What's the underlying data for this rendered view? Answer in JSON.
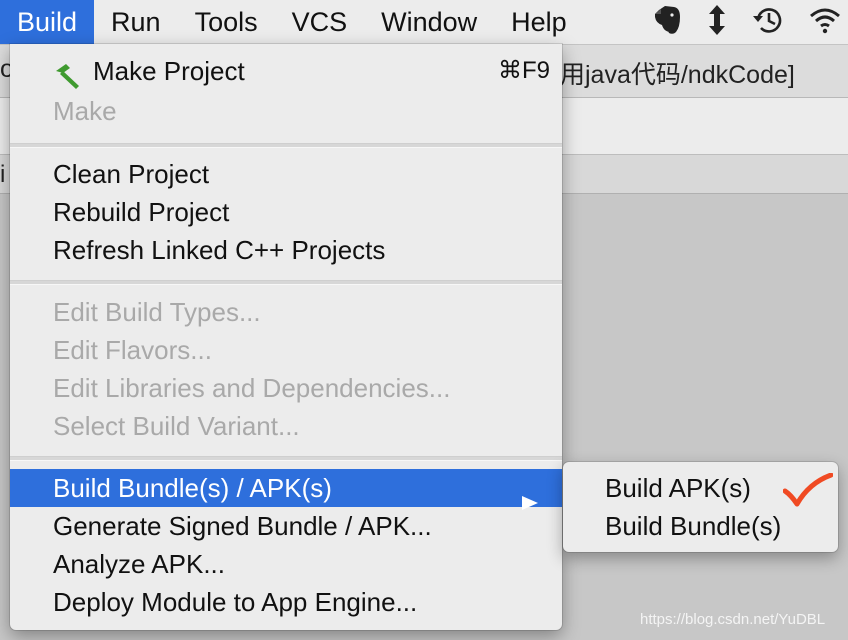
{
  "menubar": {
    "items": [
      {
        "label": "Build",
        "active": true
      },
      {
        "label": "Run"
      },
      {
        "label": "Tools"
      },
      {
        "label": "VCS"
      },
      {
        "label": "Window"
      },
      {
        "label": "Help"
      }
    ],
    "icons": [
      "evernote-icon",
      "sort-arrows-icon",
      "time-machine-icon",
      "wifi-icon"
    ]
  },
  "window": {
    "title_fragment": "用java代码/ndkCode]",
    "title_left_fragment": "o",
    "tab_left_fragment": "i"
  },
  "build_menu": {
    "items": [
      {
        "label": "Make Project",
        "shortcut": "⌘F9",
        "icon": "hammer-icon",
        "disabled": false
      },
      {
        "label": "Make",
        "disabled": true
      },
      {
        "label": "Clean Project",
        "disabled": false
      },
      {
        "label": "Rebuild Project",
        "disabled": false
      },
      {
        "label": "Refresh Linked C++ Projects",
        "disabled": false
      },
      {
        "label": "Edit Build Types...",
        "disabled": true
      },
      {
        "label": "Edit Flavors...",
        "disabled": true
      },
      {
        "label": "Edit Libraries and Dependencies...",
        "disabled": true
      },
      {
        "label": "Select Build Variant...",
        "disabled": true
      },
      {
        "label": "Build Bundle(s) / APK(s)",
        "highlighted": true,
        "has_submenu": true
      },
      {
        "label": "Generate Signed Bundle / APK...",
        "disabled": false
      },
      {
        "label": "Analyze APK...",
        "disabled": false
      },
      {
        "label": "Deploy Module to App Engine...",
        "disabled": false
      }
    ]
  },
  "submenu": {
    "items": [
      {
        "label": "Build APK(s)",
        "annotation": "red-checkmark-icon"
      },
      {
        "label": "Build Bundle(s)"
      }
    ]
  },
  "watermark": "https://blog.csdn.net/YuDBL",
  "colors": {
    "highlight": "#2e6fdc",
    "menu_bg": "#ececec",
    "disabled_text": "#a9a9a9",
    "check_red": "#f04a23"
  }
}
